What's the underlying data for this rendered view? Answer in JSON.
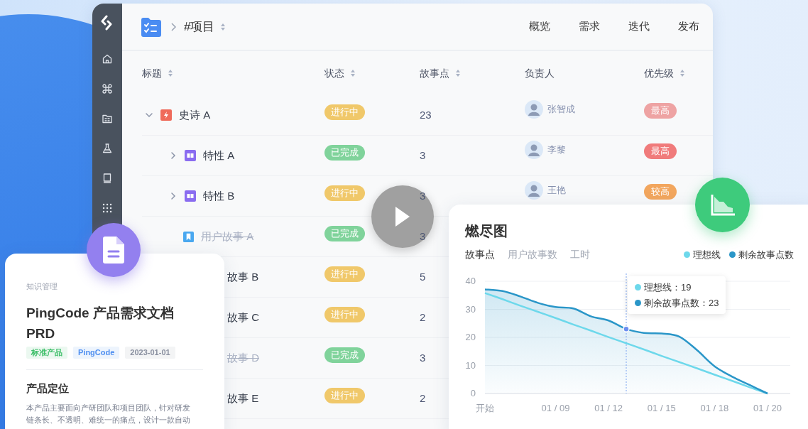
{
  "header": {
    "breadcrumb": "#项目",
    "nav": [
      "概览",
      "需求",
      "迭代",
      "发布"
    ]
  },
  "table": {
    "columns": [
      {
        "label": "标题",
        "sortable": true
      },
      {
        "label": "状态",
        "sortable": true
      },
      {
        "label": "故事点",
        "sortable": true
      },
      {
        "label": "负责人",
        "sortable": false
      },
      {
        "label": "优先级",
        "sortable": true
      }
    ],
    "rows": [
      {
        "title": "史诗 A",
        "kind": "epic",
        "expanded": true,
        "done": false,
        "status": {
          "text": "进行中",
          "color": "#f0c86a"
        },
        "points": "23",
        "assignee": "张智成",
        "priority": {
          "text": "最高",
          "color": "#eea3a3"
        },
        "children": [
          {
            "title": "特性 A",
            "kind": "feature",
            "expanded": false,
            "done": false,
            "status": {
              "text": "已完成",
              "color": "#80d39b"
            },
            "points": "3",
            "assignee": "李黎",
            "priority": {
              "text": "最高",
              "color": "#f07b7b"
            }
          },
          {
            "title": "特性 B",
            "kind": "feature",
            "expanded": false,
            "done": false,
            "status": {
              "text": "进行中",
              "color": "#f0c86a"
            },
            "points": "3",
            "assignee": "王艳",
            "priority": {
              "text": "较高",
              "color": "#f2a65e"
            }
          },
          {
            "title": "用户故事 A",
            "kind": "story",
            "done": true,
            "status": {
              "text": "已完成",
              "color": "#80d39b"
            },
            "points": "3"
          },
          {
            "title": "故事 B",
            "kind": "story_covered",
            "done": false,
            "status": {
              "text": "进行中",
              "color": "#f0c86a"
            },
            "points": "5"
          },
          {
            "title": "故事 C",
            "kind": "story_covered",
            "done": false,
            "status": {
              "text": "进行中",
              "color": "#f0c86a"
            },
            "points": "2"
          },
          {
            "title": "故事 D",
            "kind": "story_covered",
            "done": true,
            "status": {
              "text": "已完成",
              "color": "#80d39b"
            },
            "points": "3"
          },
          {
            "title": "故事 E",
            "kind": "story_covered",
            "done": false,
            "status": {
              "text": "进行中",
              "color": "#f0c86a"
            },
            "points": "2"
          }
        ]
      }
    ]
  },
  "doc_card": {
    "category": "知识管理",
    "title": "PingCode 产品需求文档 PRD",
    "tags": [
      {
        "text": "标准产品",
        "color": "#3fbf6a"
      },
      {
        "text": "PingCode",
        "color": "#4f8ff0"
      },
      {
        "text": "2023-01-01",
        "color": "#8a90a0"
      }
    ],
    "heading": "产品定位",
    "paragraph": "本产品主要面向产研团队和项目团队，针对研发链条长、不透明、难统一的痛点，设计一款自动"
  },
  "chart_card": {
    "title": "燃尽图",
    "tabs": [
      {
        "label": "故事点",
        "selected": true
      },
      {
        "label": "用户故事数",
        "selected": false
      },
      {
        "label": "工时",
        "selected": false
      }
    ],
    "chart_data": {
      "type": "area",
      "categories": [
        "开始",
        null,
        null,
        null,
        "01 / 09",
        null,
        null,
        "01 / 12",
        null,
        null,
        "01 / 15",
        null,
        null,
        "01 / 18",
        null,
        null,
        "01 / 20"
      ],
      "series": [
        {
          "name": "理想线",
          "type": "line",
          "color": "#6dd8eb",
          "values": [
            35.8,
            33.6,
            31.3,
            29.1,
            26.9,
            24.6,
            22.4,
            20.1,
            17.9,
            15.7,
            13.4,
            11.2,
            9,
            6.7,
            4.5,
            2.2,
            0
          ]
        },
        {
          "name": "剩余故事点数",
          "type": "area",
          "color": "#2a96c8",
          "values": [
            37.1,
            36.5,
            34.6,
            32.3,
            30.8,
            30.3,
            27.5,
            26,
            23,
            21.6,
            21.4,
            20.3,
            15.5,
            9.7,
            6,
            3,
            0
          ]
        }
      ],
      "ylim": [
        0,
        40
      ],
      "yticks": [
        0,
        10,
        20,
        30,
        40
      ],
      "grid": true,
      "annotations": [
        "理想线：19",
        "剩余故事点数：23"
      ]
    }
  }
}
